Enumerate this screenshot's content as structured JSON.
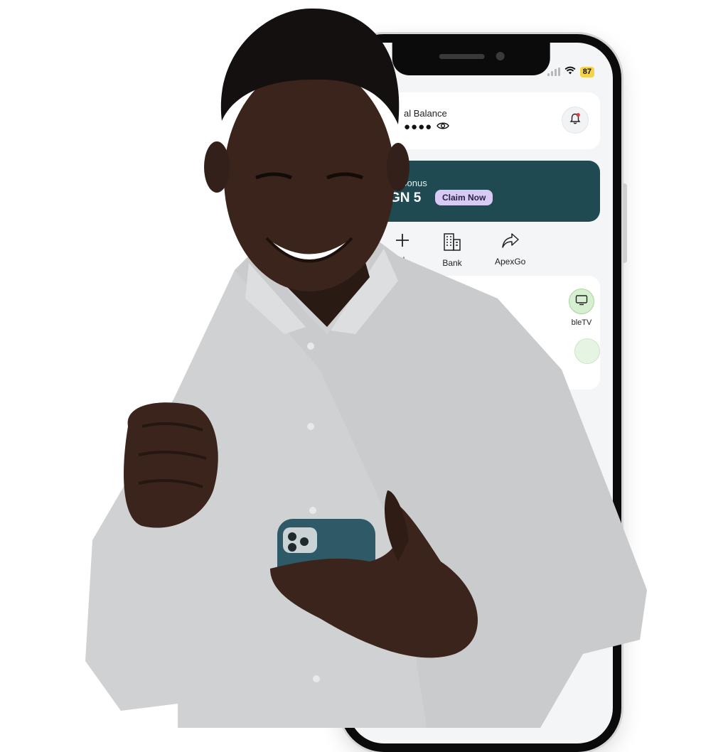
{
  "status_bar": {
    "battery": "87"
  },
  "balance": {
    "label": "al Balance",
    "hidden_value": "●●●●"
  },
  "bonus": {
    "title": "ily Bonus",
    "amount": "GN 5",
    "claim_label": "Claim Now"
  },
  "quick_actions": [
    {
      "label": "d",
      "icon": "plus-icon"
    },
    {
      "label": "Bank",
      "icon": "bank-building-icon"
    },
    {
      "label": "ApexGo",
      "icon": "share-arrow-icon"
    }
  ],
  "services": [
    {
      "label": "bleTV",
      "icon": "tv-icon"
    }
  ],
  "colors": {
    "bonus_card": "#1f4a52",
    "claim_button": "#d9c9f5",
    "service_circle": "#d7efd1",
    "battery": "#f3d34a",
    "notification_dot": "#e23b3b"
  }
}
